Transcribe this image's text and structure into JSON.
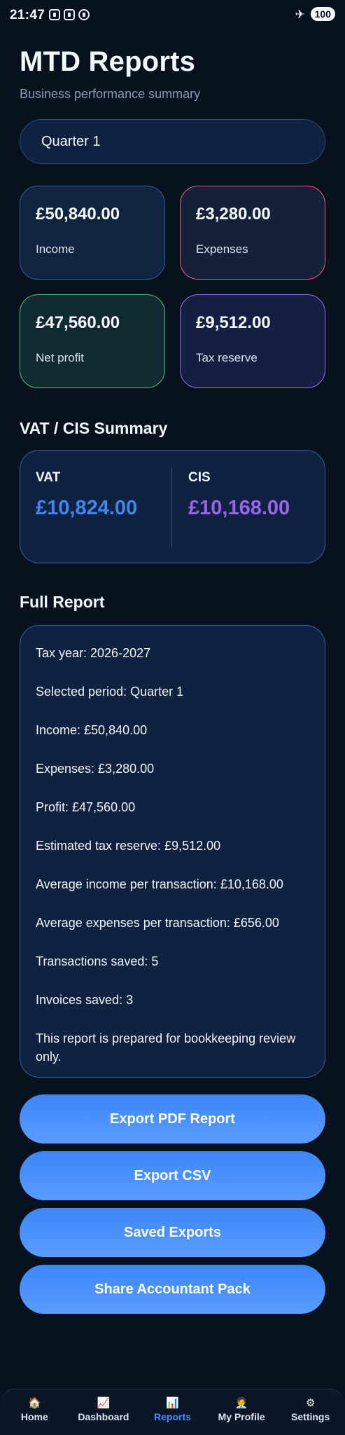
{
  "status_bar": {
    "time": "21:47",
    "battery": "100",
    "airplane_glyph": "✈"
  },
  "header": {
    "title": "MTD Reports",
    "subtitle": "Business performance summary"
  },
  "period_select": {
    "value": "Quarter 1"
  },
  "stats": {
    "income": {
      "value": "£50,840.00",
      "label": "Income"
    },
    "expenses": {
      "value": "£3,280.00",
      "label": "Expenses"
    },
    "net_profit": {
      "value": "£47,560.00",
      "label": "Net profit"
    },
    "tax_reserve": {
      "value": "£9,512.00",
      "label": "Tax reserve"
    }
  },
  "vat_cis": {
    "title": "VAT / CIS Summary",
    "vat_label": "VAT",
    "vat_amount": "£10,824.00",
    "cis_label": "CIS",
    "cis_amount": "£10,168.00"
  },
  "full_report": {
    "title": "Full Report",
    "lines": [
      "Tax year: 2026-2027",
      "Selected period: Quarter 1",
      "Income: £50,840.00",
      "Expenses: £3,280.00",
      "Profit: £47,560.00",
      "Estimated tax reserve: £9,512.00",
      "Average income per transaction: £10,168.00",
      "Average expenses per transaction: £656.00",
      "Transactions saved: 5",
      "Invoices saved: 3",
      "This report is prepared for bookkeeping review only."
    ]
  },
  "actions": {
    "export_pdf": "Export PDF Report",
    "export_csv": "Export CSV",
    "saved_exports": "Saved Exports",
    "share_pack": "Share Accountant Pack"
  },
  "nav": {
    "items": [
      {
        "label": "Home",
        "icon": "🏠",
        "icon_name": "home-icon"
      },
      {
        "label": "Dashboard",
        "icon": "📈",
        "icon_name": "chart-up-icon"
      },
      {
        "label": "Reports",
        "icon": "📊",
        "icon_name": "bar-chart-icon"
      },
      {
        "label": "My Profile",
        "icon": "🧑‍💼",
        "icon_name": "profile-icon"
      },
      {
        "label": "Settings",
        "icon": "⚙",
        "icon_name": "gear-icon"
      }
    ],
    "active_index": 2
  },
  "colors": {
    "background": "#07121e",
    "card": "#0f2340",
    "accent_blue": "#3f86f2",
    "accent_purple": "#9a63ec",
    "expenses_border": "#ee5d85",
    "net_profit_border": "#48c774",
    "tax_border": "#9a6cf5"
  }
}
